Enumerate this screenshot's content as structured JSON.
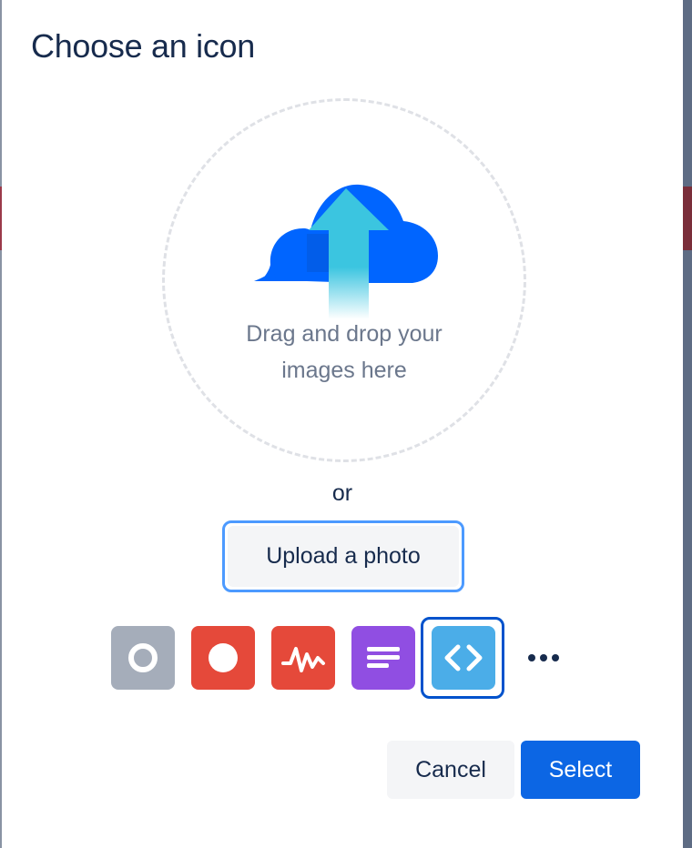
{
  "dialog": {
    "title": "Choose an icon"
  },
  "dropzone": {
    "line1": "Drag and drop your",
    "line2": "images here",
    "illustration": "cloud-upload-icon"
  },
  "separator": "or",
  "upload": {
    "label": "Upload a photo"
  },
  "icons": [
    {
      "name": "circle-outline-icon",
      "bg": "#a5adba"
    },
    {
      "name": "filled-circle-icon",
      "bg": "#e5493a"
    },
    {
      "name": "pulse-icon",
      "bg": "#e5493a"
    },
    {
      "name": "text-lines-icon",
      "bg": "#904ee2"
    },
    {
      "name": "code-brackets-icon",
      "bg": "#4bade8",
      "selected": true
    }
  ],
  "more": {
    "icon": "more-dots-icon"
  },
  "footer": {
    "cancel_label": "Cancel",
    "select_label": "Select"
  },
  "colors": {
    "primary": "#0c66e4",
    "focus": "#4c9aff",
    "text": "#172b4d",
    "subtle_text": "#6b778c"
  }
}
